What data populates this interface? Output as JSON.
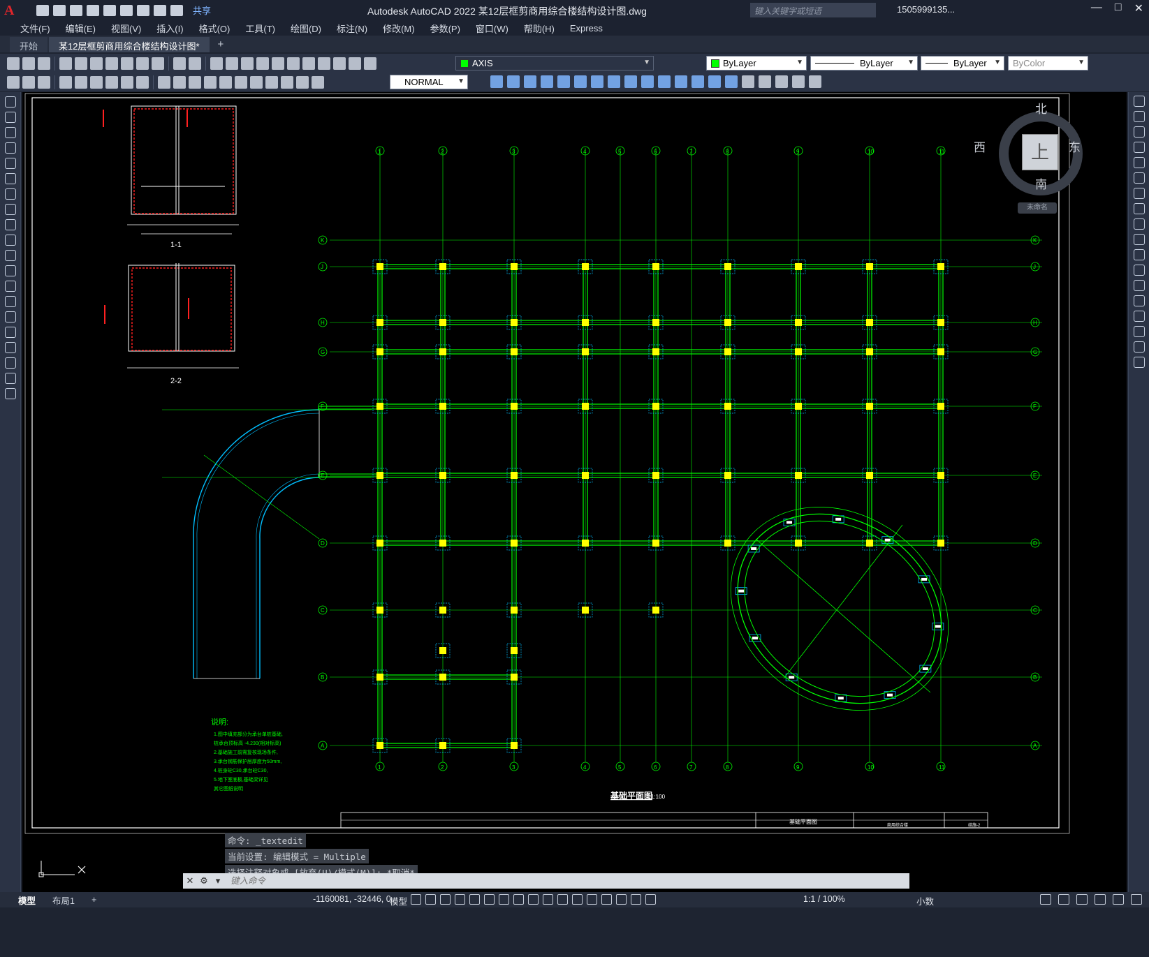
{
  "app": {
    "title": "Autodesk AutoCAD 2022    某12层框剪商用综合楼结构设计图.dwg",
    "share": "共享",
    "search_placeholder": "键入关键字或短语",
    "user": "1505999135...",
    "logo": "A"
  },
  "menu": [
    "文件(F)",
    "编辑(E)",
    "视图(V)",
    "插入(I)",
    "格式(O)",
    "工具(T)",
    "绘图(D)",
    "标注(N)",
    "修改(M)",
    "参数(P)",
    "窗口(W)",
    "帮助(H)",
    "Express"
  ],
  "tabs": {
    "start": "开始",
    "document": "某12层框剪商用综合楼结构设计图*"
  },
  "toolbar": {
    "layer": "AXIS",
    "color": "ByLayer",
    "linetype": "ByLayer",
    "lineweight": "ByLayer",
    "plotstyle": "ByColor",
    "textstyle": "NORMAL",
    "layer_color": "#00ff00"
  },
  "viewcube": {
    "north": "北",
    "south": "南",
    "east": "东",
    "west": "西",
    "top": "上",
    "wcs": "未命名"
  },
  "drawing": {
    "plan_title": "基础平面图",
    "plan_scale": "1:100",
    "section_1": "1-1",
    "section_2": "2-2",
    "notes_title": "说明:",
    "notes": [
      "1.图中填充部分为承台单桩基础,",
      "  桩承台顶标高 -4.230(相对标高)",
      "2.基础施工前需复核现场条件,",
      "3.承台钢筋保护层厚度为50mm,",
      "4.桩身砼C30,承台砼C30,",
      "5.地下室底板,基础梁详见",
      "  其它图纸说明"
    ],
    "title_block": "基础平面图",
    "title_block_sub": "商用综合楼",
    "title_block_no": "结施-2",
    "axis_top": [
      "1",
      "2",
      "3",
      "4",
      "5",
      "6",
      "7",
      "8",
      "9",
      "10",
      "11"
    ],
    "axis_side": [
      "K",
      "J",
      "H",
      "G",
      "F",
      "E",
      "D",
      "C",
      "B",
      "A"
    ]
  },
  "command": {
    "history": [
      "命令: _textedit",
      "当前设置: 编辑模式 = Multiple",
      "选择注释对象或 [放弃(U)/模式(M)]: *取消*"
    ],
    "placeholder": "键入命令"
  },
  "status": {
    "model_tab": "模型",
    "layout_tab": "布局1",
    "add": "+",
    "coords": "-1160081, -32446, 0",
    "space": "模型",
    "scale": "1:1 / 100%",
    "units": "小数"
  },
  "colors": {
    "green": "#00ff00",
    "yellow": "#ffff00",
    "cyan": "#00bfff",
    "red": "#ff2020",
    "white": "#ffffff"
  }
}
